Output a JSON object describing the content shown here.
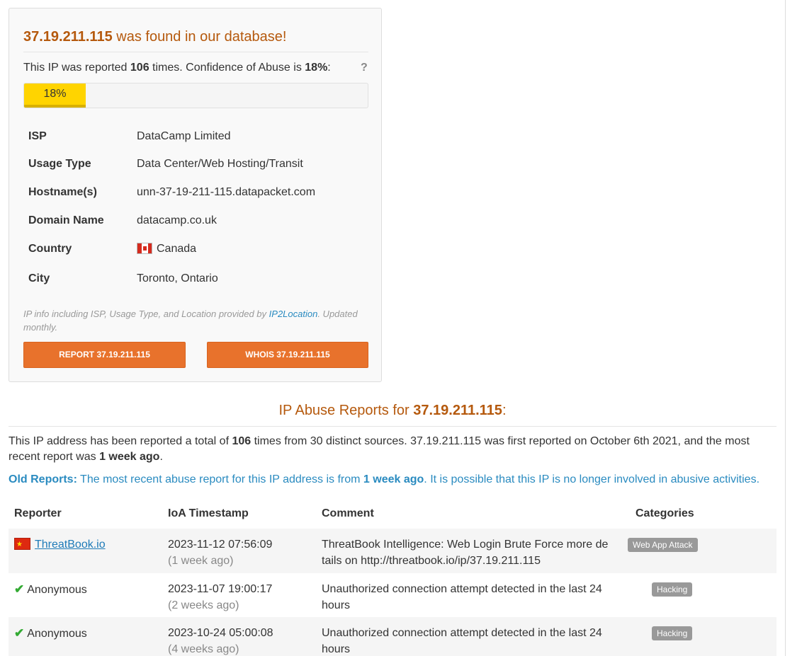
{
  "card": {
    "ip": "37.19.211.115",
    "title_suffix": " was found in our database!",
    "reported_prefix": "This IP was reported ",
    "reported_count": "106",
    "reported_mid": " times. Confidence of Abuse is ",
    "confidence": "18%",
    "reported_suffix": ":",
    "help": "?",
    "progress_label": "18%",
    "progress_fraction": 0.18,
    "info": [
      {
        "key": "ISP",
        "value": "DataCamp Limited"
      },
      {
        "key": "Usage Type",
        "value": "Data Center/Web Hosting/Transit"
      },
      {
        "key": "Hostname(s)",
        "value": "unn-37-19-211-115.datapacket.com"
      },
      {
        "key": "Domain Name",
        "value": "datacamp.co.uk"
      },
      {
        "key": "Country",
        "value": "Canada"
      },
      {
        "key": "City",
        "value": "Toronto, Ontario"
      }
    ],
    "credit_prefix": "IP info including ISP, Usage Type, and Location provided by ",
    "credit_link": "IP2Location",
    "credit_suffix": ". Updated monthly.",
    "report_button": "REPORT 37.19.211.115",
    "whois_button": "WHOIS 37.19.211.115"
  },
  "section": {
    "title_prefix": "IP Abuse Reports for ",
    "ip": "37.19.211.115",
    "title_suffix": ":",
    "summary_1": "This IP address has been reported a total of ",
    "summary_count": "106",
    "summary_2": " times from 30 distinct sources. 37.19.211.115 was first reported on October 6th 2021, and the most recent report was ",
    "summary_recent": "1 week ago",
    "summary_3": ".",
    "old_label": "Old Reports:",
    "old_1": " The most recent abuse report for this IP address is from ",
    "old_recent": "1 week ago",
    "old_2": ". It is possible that this IP is no longer involved in abusive activities."
  },
  "table": {
    "headers": [
      "Reporter",
      "IoA Timestamp",
      "Comment",
      "Categories"
    ],
    "rows": [
      {
        "reporter": "ThreatBook.io",
        "timestamp": "2023-11-12 07:56:09",
        "ago": "(1 week ago)",
        "comment": "ThreatBook Intelligence: Web Login Brute Force more details on http://threatbook.io/ip/37.19.211.115",
        "category": "Web App Attack"
      },
      {
        "reporter": "Anonymous",
        "timestamp": "2023-11-07 19:00:17",
        "ago": "(2 weeks ago)",
        "comment": "Unauthorized connection attempt detected in the last 24 hours",
        "category": "Hacking"
      },
      {
        "reporter": "Anonymous",
        "timestamp": "2023-10-24 05:00:08",
        "ago": "(4 weeks ago)",
        "comment": "Unauthorized connection attempt detected in the last 24 hours",
        "category": "Hacking"
      }
    ]
  },
  "icons": {
    "checkmark": "✔",
    "flag_reporter": "cn-flag-icon",
    "flag_country": "ca-flag-icon"
  }
}
